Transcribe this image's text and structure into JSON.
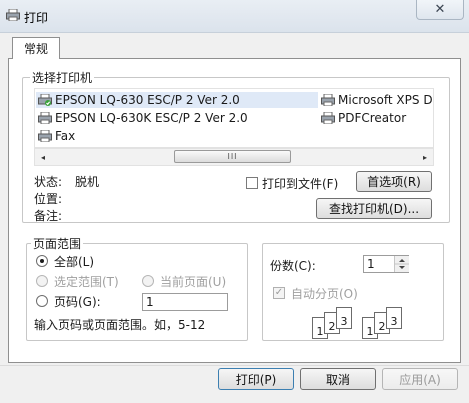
{
  "window": {
    "title": "打印",
    "close_glyph": "✕"
  },
  "tabs": [
    {
      "label": "常规"
    }
  ],
  "select_printer": {
    "legend": "选择打印机",
    "printers": [
      {
        "name": "EPSON LQ-630 ESC/P 2 Ver 2.0",
        "icon": "printer-default-icon",
        "selected": true
      },
      {
        "name": "EPSON LQ-630K ESC/P 2 Ver 2.0",
        "icon": "printer-icon"
      },
      {
        "name": "Fax",
        "icon": "fax-printer-icon"
      },
      {
        "name": "Microsoft XPS D",
        "icon": "printer-icon"
      },
      {
        "name": "PDFCreator",
        "icon": "printer-icon"
      }
    ],
    "scroll_left": "◂",
    "scroll_right": "▸",
    "scroll_thumb": "III"
  },
  "status": {
    "state_label": "状态:",
    "state_value": "脱机",
    "location_label": "位置:",
    "comment_label": "备注:"
  },
  "print_to_file_label": "打印到文件(F)",
  "preferences_button": "首选项(R)",
  "find_printer_button": "查找打印机(D)...",
  "page_range": {
    "legend": "页面范围",
    "all_label": "全部(L)",
    "selection_label": "选定范围(T)",
    "current_page_label": "当前页面(U)",
    "pages_label": "页码(G):",
    "pages_value": "1",
    "hint": "输入页码或页面范围。如，5-12"
  },
  "copies": {
    "label": "份数(C):",
    "value": "1",
    "collate_label": "自动分页(O)",
    "collate_check": "✓",
    "stack_numbers": [
      "1",
      "2",
      "3"
    ]
  },
  "footer": {
    "print_button": "打印(P)",
    "cancel_button": "取消",
    "apply_button": "应用(A)"
  }
}
